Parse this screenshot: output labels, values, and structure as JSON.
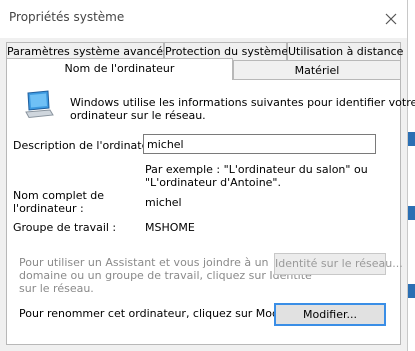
{
  "window": {
    "title": "Propriétés système"
  },
  "tabs_back": [
    {
      "label": "Paramètres système avancés"
    },
    {
      "label": "Protection du système"
    },
    {
      "label": "Utilisation à distance"
    }
  ],
  "tabs_front": [
    {
      "label": "Nom de l'ordinateur",
      "selected": true
    },
    {
      "label": "Matériel"
    }
  ],
  "content": {
    "intro_line1": "Windows utilise les informations suivantes pour identifier votre",
    "intro_line2": "ordinateur sur le réseau.",
    "description_label": "Description de l'ordinateur :",
    "description_value": "michel",
    "example_line1": "Par exemple : \"L'ordinateur du salon\" ou",
    "example_line2": "\"L'ordinateur d'Antoine\".",
    "fullname_label_line1": "Nom complet de",
    "fullname_label_line2": "l'ordinateur :",
    "fullname_value": "michel",
    "workgroup_label": "Groupe de travail :",
    "workgroup_value": "MSHOME",
    "assistant_line1": "Pour utiliser un Assistant et vous joindre à un",
    "assistant_line2": "domaine ou un groupe de travail, cliquez sur Identité",
    "assistant_line3": "sur le réseau.",
    "network_id_button": "Identité sur le réseau...",
    "rename_text": "Pour renommer cet ordinateur, cliquez sur Modifier.",
    "modify_button": "Modifier..."
  },
  "colors": {
    "focus_border": "#3a8ee6",
    "disabled_text": "#8a8a8a"
  },
  "icons": {
    "close": "close-icon",
    "computer": "computer-icon"
  }
}
